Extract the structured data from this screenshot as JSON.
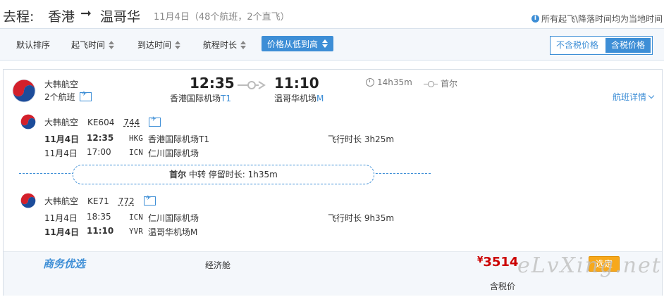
{
  "header": {
    "label": "去程:",
    "from": "香港",
    "arrow": "➞",
    "to": "温哥华",
    "summary": "11月4日（48个航班，2个直飞）",
    "tz_note": "所有起飞\\降落时间均为当地时间"
  },
  "sort": {
    "default": "默认排序",
    "depart": "起飞时间",
    "arrive": "到达时间",
    "duration": "航程时长",
    "price": "价格从低到高",
    "tax_excl": "不含税价格",
    "tax_incl": "含税价格"
  },
  "card": {
    "airline": "大韩航空",
    "legs_label": "2个航班",
    "dep_time": "12:35",
    "arr_time": "11:10",
    "dep_airport": "香港国际机场",
    "dep_terminal": "T1",
    "arr_airport": "温哥华机场",
    "arr_terminal": "M",
    "duration": "14h35m",
    "stop": "首尔",
    "details": "航班详情",
    "segments": [
      {
        "airline": "大韩航空",
        "flight": "KE604",
        "aircraft": "744",
        "dep_date": "11月4日",
        "dep_time": "12:35",
        "dep_iata": "HKG",
        "dep_airport": "香港国际机场T1",
        "arr_date": "11月4日",
        "arr_time": "17:00",
        "arr_iata": "ICN",
        "arr_airport": "仁川国际机场",
        "flight_time": "飞行时长 3h25m"
      },
      {
        "airline": "大韩航空",
        "flight": "KE71",
        "aircraft": "772",
        "dep_date": "11月4日",
        "dep_time": "18:35",
        "dep_iata": "ICN",
        "dep_airport": "仁川国际机场",
        "arr_date": "11月4日",
        "arr_time": "11:10",
        "arr_iata": "YVR",
        "arr_airport": "温哥华机场M",
        "flight_time": "飞行时长 9h35m"
      }
    ],
    "transfer": {
      "city": "首尔",
      "text": "中转 停留时长: 1h35m"
    },
    "brand": "商务优选",
    "cabin": "经济舱",
    "currency": "¥",
    "price": "3514",
    "select": "选定",
    "tax_label": "含税价"
  },
  "watermark": "eLvXing.net",
  "colors": {
    "accent": "#3d8ed6",
    "price": "#cc0000",
    "select": "#f7a81b"
  }
}
